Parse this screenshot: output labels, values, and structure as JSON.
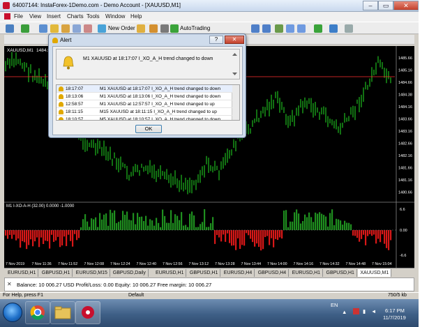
{
  "window": {
    "title": "64007144: InstaForex-1Demo.com - Demo Account - [XAUUSD,M1]",
    "controls": [
      "–",
      "▭",
      "✕"
    ]
  },
  "menu": [
    "File",
    "View",
    "Insert",
    "Charts",
    "Tools",
    "Window",
    "Help"
  ],
  "toolbar": {
    "new_order": "New Order",
    "autotrading": "AutoTrading"
  },
  "chart": {
    "symbol_label": "XAUUSD,M1",
    "ohlc_partial": "1484.5",
    "price_labels": [
      "1485.66",
      "1485.16",
      "1484.66",
      "1484.38",
      "1484.16",
      "1483.66",
      "1483.16",
      "1482.66",
      "1482.16",
      "1481.66",
      "1481.16",
      "1480.66"
    ],
    "indicator_label": "M1 I-XO-A-H (32.00) 0.0000 -1.0000",
    "indicator_scale": [
      "6.6",
      "0.00",
      "-6.6"
    ],
    "time_labels": [
      "7 Nov 2019",
      "7 Nov 11:36",
      "7 Nov 11:52",
      "7 Nov 12:08",
      "7 Nov 12:24",
      "7 Nov 12:40",
      "7 Nov 12:56",
      "7 Nov 13:12",
      "7 Nov 13:28",
      "7 Nov 13:44",
      "7 Nov 14:00",
      "7 Nov 14:16",
      "7 Nov 14:32",
      "7 Nov 14:48",
      "7 Nov 15:04"
    ],
    "colors": {
      "bull": "#22cc22",
      "ind_pos": "#1f8f1f",
      "ind_neg": "#d81818",
      "bid_line": "#ff3030"
    }
  },
  "tabs": [
    "EURUSD,H1",
    "GBPUSD,H1",
    "EURUSD,M15",
    "GBPUSD,Daily",
    "EURUSD,H1",
    "GBPUSD,H1",
    "EURUSD,H4",
    "GBPUSD,H4",
    "EURUSD,H1",
    "GBPUSD,H1",
    "XAUUSD,M1"
  ],
  "terminal": {
    "balance_line": "Balance: 10 006.27 USD  Profit/Loss: 0.00  Equity: 10 006.27  Free margin: 10 006.27"
  },
  "status": {
    "help": "For Help, press F1",
    "profile": "Default",
    "traffic": "750/5 kb"
  },
  "alert": {
    "title": "Alert",
    "help_btn": "?",
    "close_btn": "✕",
    "message": "M1 XAUUSD at 18:17:07 I_XO_A_H trend changed to down",
    "rows": [
      {
        "time": "18:17:07",
        "msg": "M1 XAUUSD at 18:17:07 I_XO_A_H trend changed to down"
      },
      {
        "time": "18:13:06",
        "msg": "M1 XAUUSD at 18:13:06 I_XO_A_H trend changed to down"
      },
      {
        "time": "12:58:57",
        "msg": "M1 XAUUSD at 12:57:57 I_XO_A_H trend changed to up"
      },
      {
        "time": "18:11:15",
        "msg": "M15 XAUUSD at 18:11:15 I_XO_A_H trend changed to up"
      },
      {
        "time": "18:10:57",
        "msg": "M5 XAUUSD at 18:10:57 I_XO_A_H trend changed to down"
      }
    ],
    "ok": "OK"
  },
  "taskbar": {
    "lang": "EN",
    "time": "6:17 PM",
    "date": "11/7/2019"
  }
}
